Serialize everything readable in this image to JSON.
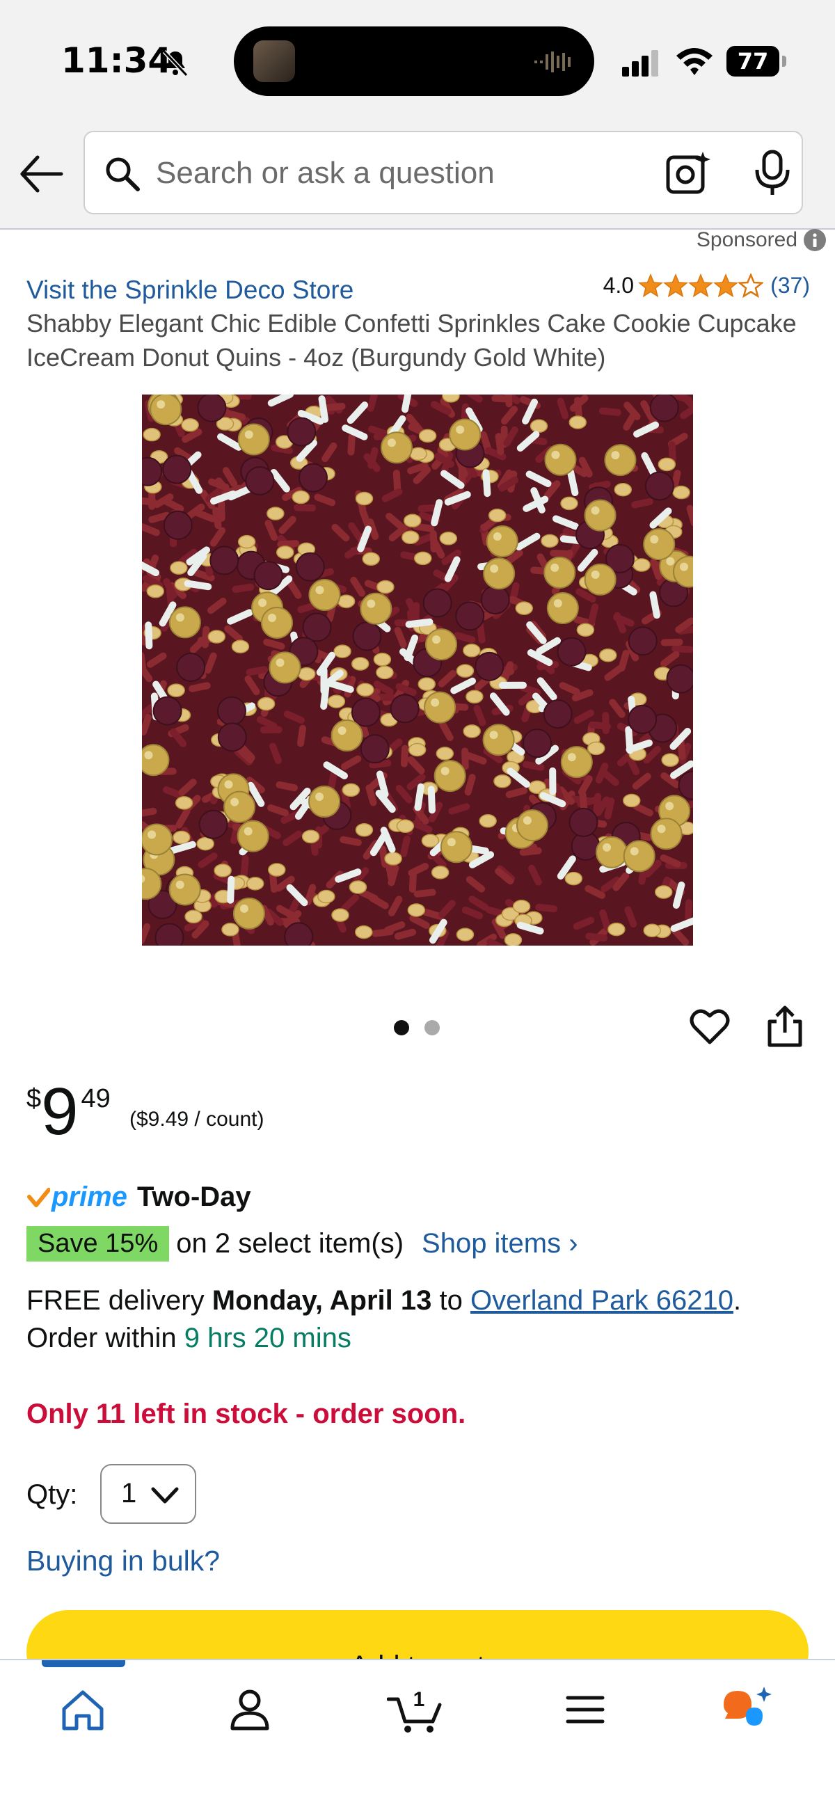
{
  "status_bar": {
    "time": "11:34",
    "battery": "77"
  },
  "search": {
    "placeholder": "Search or ask a question"
  },
  "sponsored_label": "Sponsored",
  "product": {
    "store_link": "Visit the Sprinkle Deco Store",
    "rating_value": "4.0",
    "rating_stars": 4,
    "rating_count": "(37)",
    "title": "Shabby Elegant Chic Edible Confetti Sprinkles Cake Cookie Cupcake IceCream Donut Quins - 4oz (Burgundy Gold White)",
    "image_count": 2,
    "image_index": 1
  },
  "price": {
    "symbol": "$",
    "whole": "9",
    "fraction": "49",
    "unit_price": "($9.49 / count)"
  },
  "prime": {
    "brand": "prime",
    "speed": "Two-Day"
  },
  "promo": {
    "badge": "Save 15%",
    "text": "on 2 select item(s)",
    "link": "Shop items ›"
  },
  "delivery": {
    "prefix": "FREE delivery",
    "date": "Monday, April 13",
    "to": "to",
    "location": "Overland Park 66210",
    "period": ".",
    "order_within": "Order within",
    "countdown": "9 hrs 20 mins"
  },
  "stock_message": "Only 11 left in stock - order soon.",
  "quantity": {
    "label": "Qty:",
    "value": "1"
  },
  "bulk_link": "Buying in bulk?",
  "add_to_cart_label": "Add to cart",
  "nav": {
    "cart_count": "1"
  },
  "colors": {
    "link": "#1f5b9c",
    "prime_blue": "#1a98ff",
    "stock_red": "#cc0c39",
    "timer_green": "#067d62",
    "save_badge": "#7fd864",
    "cart_button": "#ffd814",
    "star": "#f08c1a",
    "burgundy": "#7a1f2b",
    "gold": "#c9a94c"
  }
}
